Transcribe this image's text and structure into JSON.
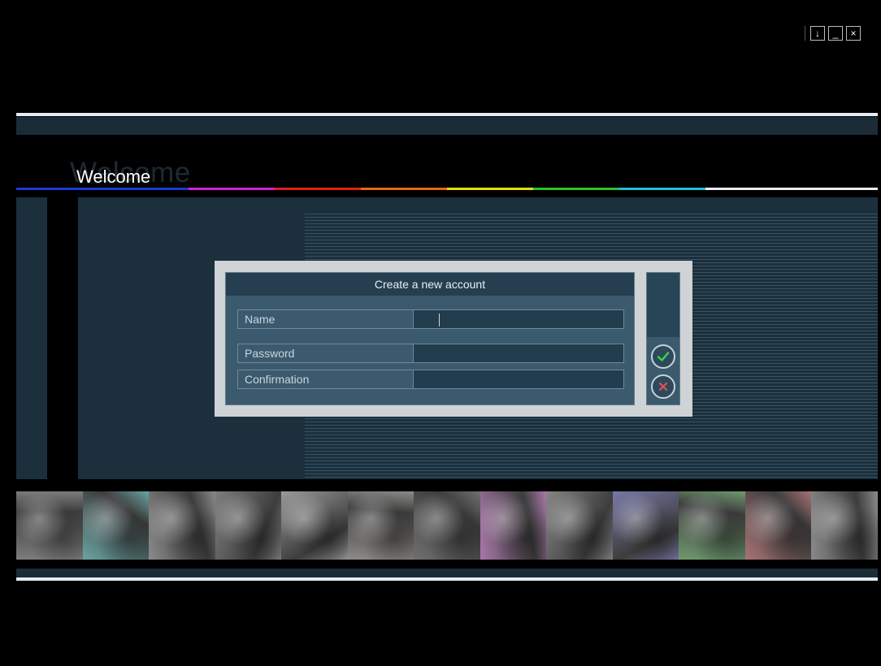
{
  "window": {
    "controls": [
      {
        "name": "download-icon",
        "glyph": "↓"
      },
      {
        "name": "minimize-icon",
        "glyph": "_"
      },
      {
        "name": "close-icon",
        "glyph": "×"
      }
    ]
  },
  "header": {
    "welcome_ghost": "Welcome",
    "welcome": "Welcome",
    "rainbow_colors": [
      "#1a3ad8",
      "#1a3ad8",
      "#d61fd6",
      "#e0201a",
      "#e06a12",
      "#e6dc14",
      "#2fc22a",
      "#1bc2d8",
      "#e6eef2",
      "#e6eef2"
    ]
  },
  "dialog": {
    "title": "Create a new account",
    "fields": {
      "name_label": "Name",
      "name_value": "",
      "password_label": "Password",
      "password_value": "",
      "confirmation_label": "Confirmation",
      "confirmation_value": ""
    },
    "confirm_color": "#3fd14a",
    "cancel_color": "#e2505a"
  },
  "photostrip": {
    "tints": [
      "#7c7c7c",
      "#6aa3a3",
      "#8a8a8a",
      "#7e7e7e",
      "#9a9a9a",
      "#8d8a86",
      "#6f6f6f",
      "#a977a9",
      "#858585",
      "#7777a8",
      "#6f9a6f",
      "#a77373",
      "#8a8a8a"
    ]
  }
}
